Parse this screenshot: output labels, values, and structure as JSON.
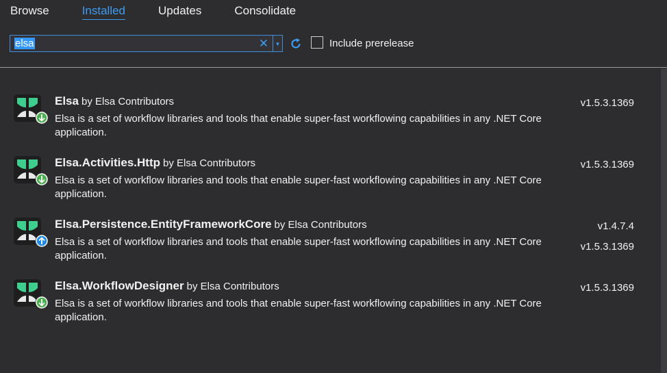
{
  "tabs": [
    {
      "label": "Browse",
      "active": false
    },
    {
      "label": "Installed",
      "active": true
    },
    {
      "label": "Updates",
      "active": false
    },
    {
      "label": "Consolidate",
      "active": false
    }
  ],
  "search": {
    "value": "elsa",
    "clear_icon": "close-icon",
    "dropdown_icon": "chevron-down-icon"
  },
  "refresh_icon": "refresh-icon",
  "include_prerelease": {
    "label": "Include prerelease",
    "checked": false
  },
  "packages": [
    {
      "name": "Elsa",
      "by": "by Elsa Contributors",
      "description": "Elsa is a set of workflow libraries and tools that enable super-fast workflowing capabilities in any .NET Core application.",
      "version": "v1.5.3.1369",
      "latest_version": "",
      "badge": "installed-down-icon"
    },
    {
      "name": "Elsa.Activities.Http",
      "by": "by Elsa Contributors",
      "description": "Elsa is a set of workflow libraries and tools that enable super-fast workflowing capabilities in any .NET Core application.",
      "version": "v1.5.3.1369",
      "latest_version": "",
      "badge": "installed-down-icon"
    },
    {
      "name": "Elsa.Persistence.EntityFrameworkCore",
      "by": "by Elsa Contributors",
      "description": "Elsa is a set of workflow libraries and tools that enable super-fast workflowing capabilities in any .NET Core application.",
      "version": "v1.4.7.4",
      "latest_version": "v1.5.3.1369",
      "badge": "update-available-icon"
    },
    {
      "name": "Elsa.WorkflowDesigner",
      "by": "by Elsa Contributors",
      "description": "Elsa is a set of workflow libraries and tools that enable super-fast workflowing capabilities in any .NET Core application.",
      "version": "v1.5.3.1369",
      "latest_version": "",
      "badge": "installed-down-icon"
    }
  ],
  "colors": {
    "background": "#2d2d30",
    "accent": "#3e9cf0",
    "logo_green": "#3ecf8e",
    "installed_badge": "#4caf50",
    "update_badge": "#1e88e5"
  }
}
